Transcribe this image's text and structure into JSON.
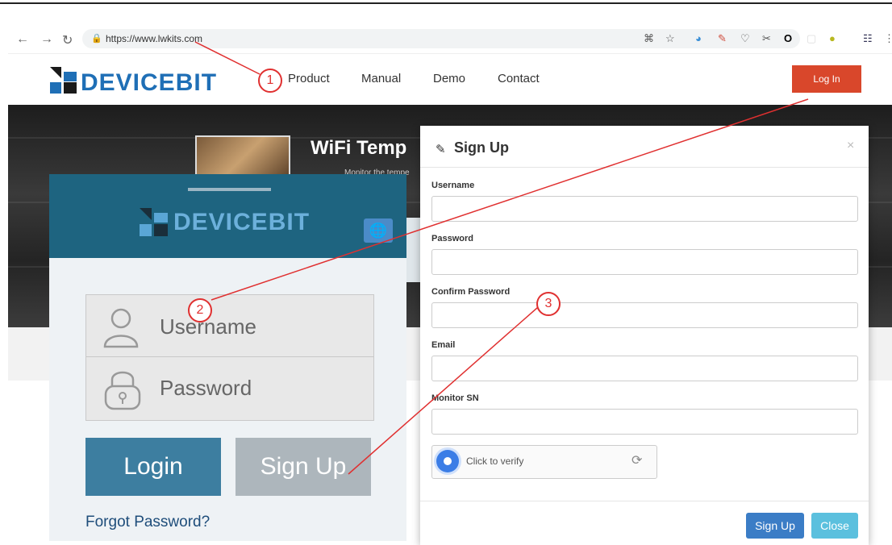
{
  "browser": {
    "url": "https://www.lwkits.com"
  },
  "site": {
    "logo_text": "DEVICEBIT",
    "nav": [
      "Product",
      "Manual",
      "Demo",
      "Contact"
    ],
    "login_label": "Log In",
    "hero_title": "WiFi Temp",
    "hero_subtitle": "Monitor the tempe"
  },
  "app": {
    "logo_text": "DEVICEBIT",
    "username_placeholder": "Username",
    "password_placeholder": "Password",
    "login_label": "Login",
    "signup_label": "Sign Up",
    "forgot_label": "Forgot Password?"
  },
  "modal": {
    "title": "Sign Up",
    "close_icon": "×",
    "fields": [
      {
        "label": "Username"
      },
      {
        "label": "Password"
      },
      {
        "label": "Confirm Password"
      },
      {
        "label": "Email"
      },
      {
        "label": "Monitor SN"
      }
    ],
    "captcha_label": "Click to verify",
    "signup_button": "Sign Up",
    "close_button": "Close"
  },
  "callouts": [
    "1",
    "2",
    "3"
  ],
  "colors": {
    "login_red": "#d9472b",
    "brand_blue": "#1f6fb6",
    "annotation_red": "#e03030",
    "app_header": "#1e6480"
  }
}
